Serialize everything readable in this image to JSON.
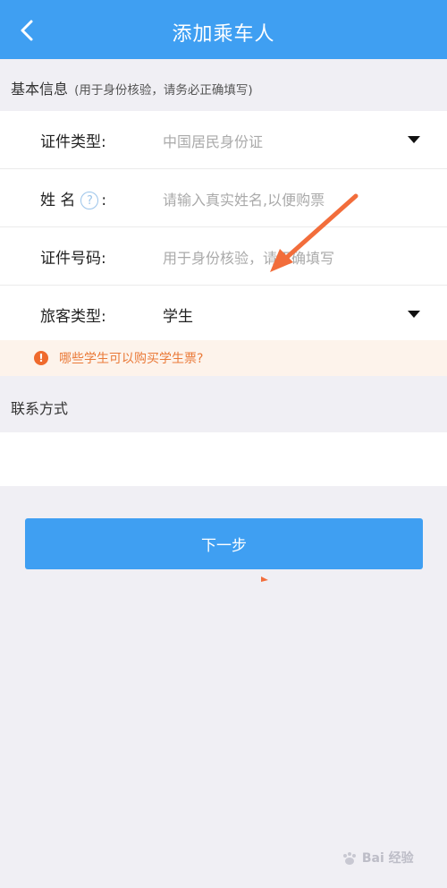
{
  "header": {
    "title": "添加乘车人",
    "back_icon": "chevron-left-icon"
  },
  "basic_section": {
    "title": "基本信息",
    "hint": "(用于身份核验，请务必正确填写)"
  },
  "form": {
    "id_type": {
      "label": "证件类型:",
      "value": "中国居民身份证"
    },
    "name": {
      "label_main": "姓 名",
      "label_colon": ":",
      "help_icon": "question-mark-icon",
      "help_glyph": "?",
      "placeholder": "请输入真实姓名,以便购票"
    },
    "id_number": {
      "label": "证件号码:",
      "placeholder": "用于身份核验，请正确填写"
    },
    "passenger_type": {
      "label": "旅客类型:",
      "value": "学生"
    }
  },
  "notice": {
    "icon": "exclamation-icon",
    "glyph": "!",
    "text": "哪些学生可以购买学生票?"
  },
  "contact_section": {
    "title": "联系方式"
  },
  "next_button": {
    "label": "下一步"
  },
  "watermark": {
    "text": "Bai 经验"
  },
  "colors": {
    "primary": "#3f9ff2",
    "notice_bg": "#fdf3eb",
    "notice_text": "#ea7a39",
    "annotation_arrow": "#f26d3b",
    "background": "#f0eff4"
  }
}
